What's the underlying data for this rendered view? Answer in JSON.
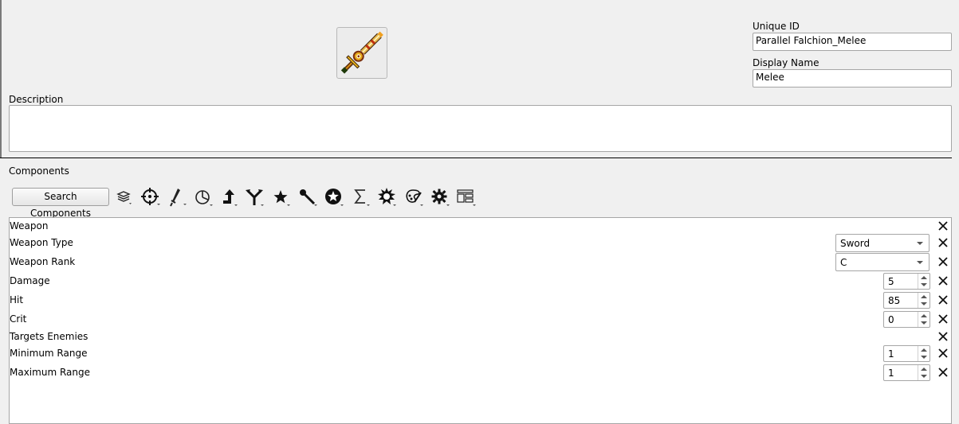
{
  "header": {
    "unique_id_label": "Unique ID",
    "unique_id_value": "Parallel Falchion_Melee",
    "display_name_label": "Display Name",
    "display_name_value": "Melee",
    "description_label": "Description",
    "description_value": "",
    "item_icon": "sword-sprite-icon"
  },
  "components": {
    "section_label": "Components",
    "search_label": "Search Components",
    "toolbar_icons": [
      "layers-icon",
      "crosshair-icon",
      "sword-icon",
      "pie-clock-icon",
      "arrow-up-icon",
      "branch-icon",
      "star-icon",
      "wand-icon",
      "star-badge-icon",
      "sigma-icon",
      "burst-icon",
      "palette-icon",
      "gear-icon",
      "layout-icon"
    ],
    "rows": [
      {
        "label": "Weapon",
        "control": "none"
      },
      {
        "label": "Weapon Type",
        "control": "combo",
        "value": "Sword"
      },
      {
        "label": "Weapon Rank",
        "control": "combo",
        "value": "C"
      },
      {
        "label": "Damage",
        "control": "spin",
        "value": "5"
      },
      {
        "label": "Hit",
        "control": "spin",
        "value": "85"
      },
      {
        "label": "Crit",
        "control": "spin",
        "value": "0"
      },
      {
        "label": "Targets Enemies",
        "control": "none"
      },
      {
        "label": "Minimum Range",
        "control": "spin",
        "value": "1"
      },
      {
        "label": "Maximum Range",
        "control": "spin",
        "value": "1"
      }
    ]
  }
}
